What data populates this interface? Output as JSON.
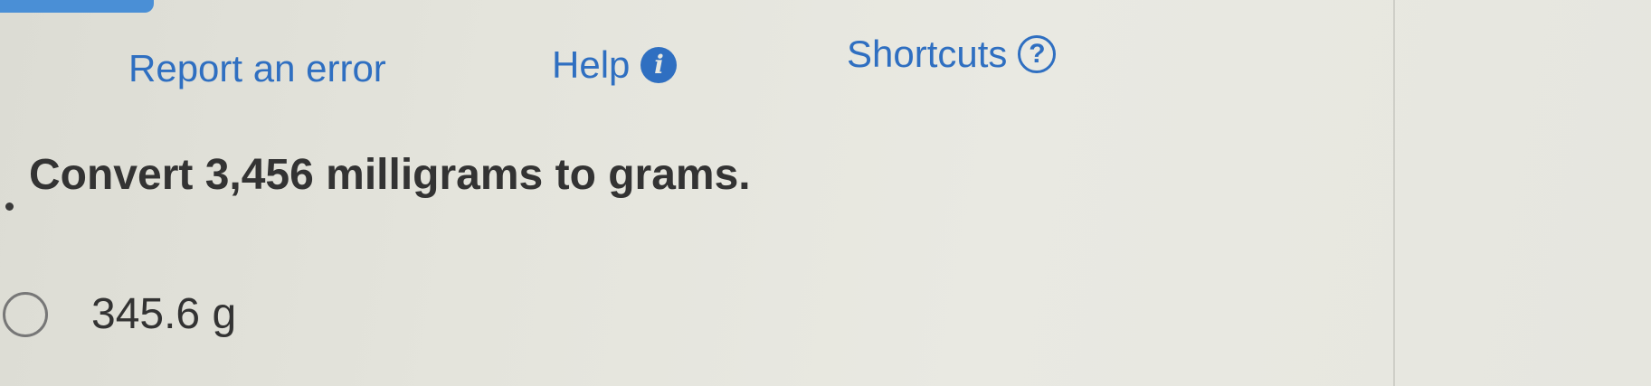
{
  "header": {
    "report_label": "Report an error",
    "help_label": "Help",
    "help_icon": "info-icon",
    "shortcuts_label": "Shortcuts",
    "shortcuts_icon": "help-circle-icon",
    "link_color": "#2f6fc1"
  },
  "question": {
    "text": "Convert 3,456 milligrams to grams."
  },
  "choices": [
    {
      "label": "345.6 g",
      "selected": false
    }
  ]
}
